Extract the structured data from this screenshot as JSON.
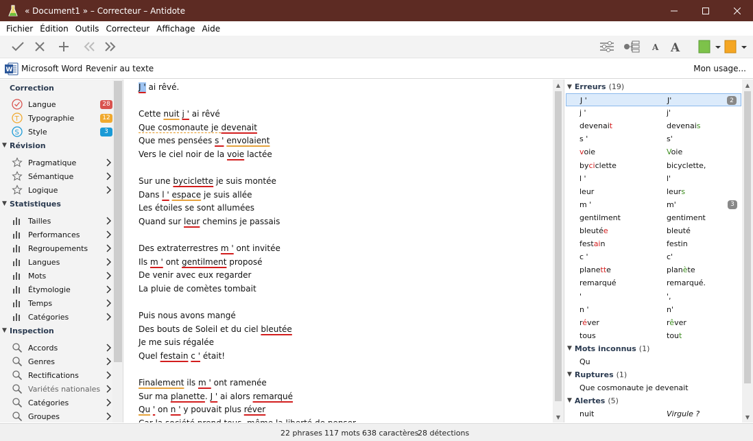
{
  "window": {
    "title": "« Document1 » – Correcteur – Antidote"
  },
  "menu": [
    "Fichier",
    "Édition",
    "Outils",
    "Correcteur",
    "Affichage",
    "Aide"
  ],
  "wordbar": {
    "app_label": "Microsoft Word",
    "back_label": "Revenir au texte",
    "usage_label": "Mon usage..."
  },
  "sidebar": {
    "correction_title": "Correction",
    "correction_items": [
      {
        "label": "Langue",
        "badge": "28",
        "color": "#d9534f"
      },
      {
        "label": "Typographie",
        "badge": "12",
        "color": "#f0a92e"
      },
      {
        "label": "Style",
        "badge": "3",
        "color": "#1a9ad6"
      }
    ],
    "revision_title": "Révision",
    "revision_items": [
      "Pragmatique",
      "Sémantique",
      "Logique"
    ],
    "stats_title": "Statistiques",
    "stats_items": [
      "Tailles",
      "Performances",
      "Regroupements",
      "Langues",
      "Mots",
      "Étymologie",
      "Temps",
      "Catégories"
    ],
    "inspection_title": "Inspection",
    "inspection_items": [
      "Accords",
      "Genres",
      "Rectifications",
      "Variétés nationales",
      "Catégories",
      "Groupes"
    ]
  },
  "document": {
    "lines": [
      [
        {
          "t": "J '",
          "s": "sel"
        },
        {
          "t": " ai rêvé."
        }
      ],
      [],
      [
        {
          "t": "Cette "
        },
        {
          "t": "nuit",
          "s": "warn"
        },
        {
          "t": " "
        },
        {
          "t": "j '",
          "s": "err"
        },
        {
          "t": " ai rêvé"
        }
      ],
      [
        {
          "t": "Que cosmonaute je ",
          "s": "dash"
        },
        {
          "t": "devenait",
          "s": "err"
        }
      ],
      [
        {
          "t": "Que mes pensées "
        },
        {
          "t": "s '",
          "s": "err"
        },
        {
          "t": " "
        },
        {
          "t": "envolaient",
          "s": "warn"
        }
      ],
      [
        {
          "t": "Vers le ciel noir de la "
        },
        {
          "t": "voie",
          "s": "err"
        },
        {
          "t": " lactée"
        }
      ],
      [],
      [
        {
          "t": "Sur une "
        },
        {
          "t": "byciclette",
          "s": "err"
        },
        {
          "t": " je suis montée"
        }
      ],
      [
        {
          "t": "Dans "
        },
        {
          "t": "l '",
          "s": "err"
        },
        {
          "t": " "
        },
        {
          "t": "espace",
          "s": "warn"
        },
        {
          "t": " je suis allée"
        }
      ],
      [
        {
          "t": "Les étoiles se sont allumées"
        }
      ],
      [
        {
          "t": "Quand sur "
        },
        {
          "t": "leur",
          "s": "err"
        },
        {
          "t": " chemins je passais"
        }
      ],
      [],
      [
        {
          "t": "Des extraterrestres "
        },
        {
          "t": "m '",
          "s": "err"
        },
        {
          "t": " ont invitée"
        }
      ],
      [
        {
          "t": "Ils "
        },
        {
          "t": "m '",
          "s": "err"
        },
        {
          "t": " ont "
        },
        {
          "t": "gentilment",
          "s": "err"
        },
        {
          "t": " proposé"
        }
      ],
      [
        {
          "t": "De venir avec eux regarder"
        }
      ],
      [
        {
          "t": "La pluie de comètes tombait"
        }
      ],
      [],
      [
        {
          "t": "Puis nous avons mangé"
        }
      ],
      [
        {
          "t": "Des bouts de Soleil et du ciel "
        },
        {
          "t": "bleutée",
          "s": "err"
        }
      ],
      [
        {
          "t": "Je me suis régalée"
        }
      ],
      [
        {
          "t": "Quel "
        },
        {
          "t": "festain",
          "s": "err"
        },
        {
          "t": " "
        },
        {
          "t": "c '",
          "s": "err"
        },
        {
          "t": " était!"
        }
      ],
      [],
      [
        {
          "t": "Finalement",
          "s": "warn"
        },
        {
          "t": " ils "
        },
        {
          "t": "m '",
          "s": "err"
        },
        {
          "t": " ont ramenée"
        }
      ],
      [
        {
          "t": "Sur ma "
        },
        {
          "t": "planette",
          "s": "err"
        },
        {
          "t": ". "
        },
        {
          "t": "J '",
          "s": "err"
        },
        {
          "t": " ai alors "
        },
        {
          "t": "remarqué",
          "s": "err"
        }
      ],
      [
        {
          "t": "Qu",
          "s": "warn"
        },
        {
          "t": " "
        },
        {
          "t": "'",
          "s": "err"
        },
        {
          "t": " on "
        },
        {
          "t": "n '",
          "s": "err"
        },
        {
          "t": " y pouvait plus "
        },
        {
          "t": "réver",
          "s": "err"
        }
      ],
      [
        {
          "t": "Car la société prend tous, même la liberté de penser"
        }
      ]
    ]
  },
  "panel": {
    "errors_title": "Erreurs",
    "errors_count": "(19)",
    "errors": [
      {
        "w": [
          {
            "t": "J '"
          }
        ],
        "c": [
          {
            "t": "J'"
          }
        ],
        "n": "2",
        "sel": true
      },
      {
        "w": [
          {
            "t": "j '"
          }
        ],
        "c": [
          {
            "t": "j'"
          }
        ]
      },
      {
        "w": [
          {
            "t": "devenai"
          },
          {
            "t": "t",
            "h": "r"
          }
        ],
        "c": [
          {
            "t": "devenai"
          },
          {
            "t": "s",
            "h": "g"
          }
        ]
      },
      {
        "w": [
          {
            "t": "s '"
          }
        ],
        "c": [
          {
            "t": "s'"
          }
        ]
      },
      {
        "w": [
          {
            "t": "v",
            "h": "r"
          },
          {
            "t": "oie"
          }
        ],
        "c": [
          {
            "t": "V",
            "h": "g"
          },
          {
            "t": "oie"
          }
        ]
      },
      {
        "w": [
          {
            "t": "by"
          },
          {
            "t": "ci",
            "h": "r"
          },
          {
            "t": "clette"
          }
        ],
        "c": [
          {
            "t": "bicyclette,"
          }
        ]
      },
      {
        "w": [
          {
            "t": "l '"
          }
        ],
        "c": [
          {
            "t": "l'"
          }
        ]
      },
      {
        "w": [
          {
            "t": "leur"
          }
        ],
        "c": [
          {
            "t": "leur"
          },
          {
            "t": "s",
            "h": "g"
          }
        ]
      },
      {
        "w": [
          {
            "t": "m '"
          }
        ],
        "c": [
          {
            "t": "m'"
          }
        ],
        "n": "3"
      },
      {
        "w": [
          {
            "t": "gentilment"
          }
        ],
        "c": [
          {
            "t": "gentiment"
          }
        ]
      },
      {
        "w": [
          {
            "t": "bleuté"
          },
          {
            "t": "e",
            "h": "r"
          }
        ],
        "c": [
          {
            "t": "bleuté"
          }
        ]
      },
      {
        "w": [
          {
            "t": "fest"
          },
          {
            "t": "ai",
            "h": "r"
          },
          {
            "t": "n"
          }
        ],
        "c": [
          {
            "t": "festin"
          }
        ]
      },
      {
        "w": [
          {
            "t": "c '"
          }
        ],
        "c": [
          {
            "t": "c'"
          }
        ]
      },
      {
        "w": [
          {
            "t": "plane"
          },
          {
            "t": "tt",
            "h": "r"
          },
          {
            "t": "e"
          }
        ],
        "c": [
          {
            "t": "plan"
          },
          {
            "t": "è",
            "h": "g"
          },
          {
            "t": "te"
          }
        ]
      },
      {
        "w": [
          {
            "t": "remarqué"
          }
        ],
        "c": [
          {
            "t": "remarqué."
          }
        ]
      },
      {
        "w": [
          {
            "t": "'"
          }
        ],
        "c": [
          {
            "t": "',"
          }
        ]
      },
      {
        "w": [
          {
            "t": "n '"
          }
        ],
        "c": [
          {
            "t": "n'"
          }
        ]
      },
      {
        "w": [
          {
            "t": "r"
          },
          {
            "t": "é",
            "h": "r"
          },
          {
            "t": "ver"
          }
        ],
        "c": [
          {
            "t": "r"
          },
          {
            "t": "ê",
            "h": "g"
          },
          {
            "t": "ver"
          }
        ]
      },
      {
        "w": [
          {
            "t": "tous"
          }
        ],
        "c": [
          {
            "t": "tou"
          },
          {
            "t": "t",
            "h": "g"
          }
        ]
      }
    ],
    "unknown_title": "Mots inconnus",
    "unknown_count": "(1)",
    "unknown": [
      "Qu"
    ],
    "ruptures_title": "Ruptures",
    "ruptures_count": "(1)",
    "ruptures": [
      "Que cosmonaute je devenait"
    ],
    "alerts_title": "Alertes",
    "alerts_count": "(5)",
    "alerts": [
      {
        "w": "nuit",
        "cat": "Virgule ?"
      }
    ]
  },
  "status": {
    "phrases": "22 phrases",
    "mots": "117 mots",
    "caracteres": "638 caractères",
    "detections": "28 détections"
  }
}
